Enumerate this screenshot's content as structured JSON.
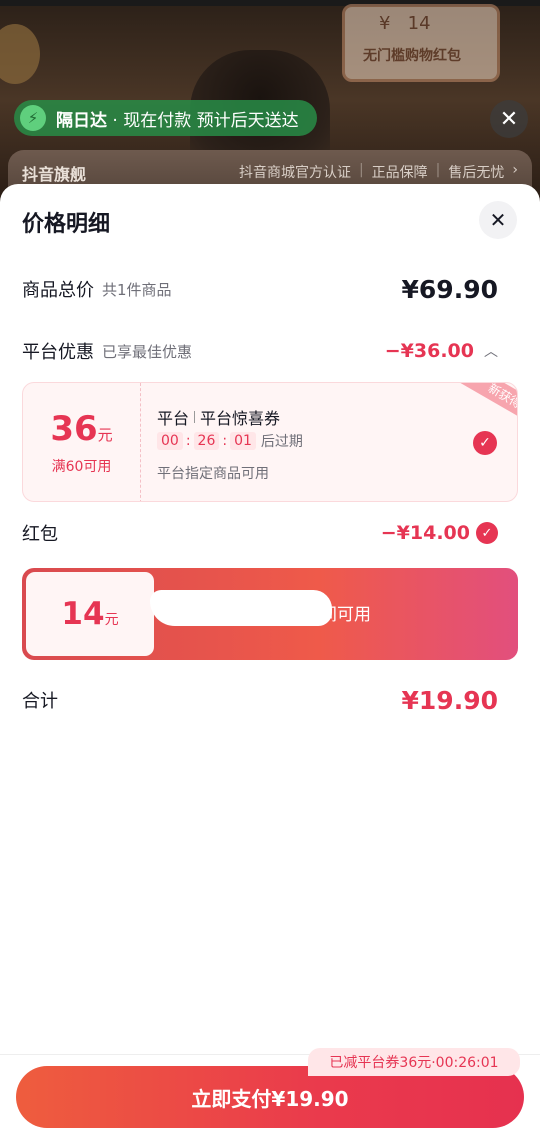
{
  "background": {
    "red_packet_card": {
      "currency": "¥",
      "amount": "14",
      "label": "无门槛购物红包"
    },
    "delivery": {
      "icon": "bolt-icon",
      "highlight": "隔日达",
      "text": " · 现在付款 预计后天送达"
    },
    "store": {
      "name": "抖音旗舰",
      "badges": [
        "抖音商城官方认证",
        "正品保障",
        "售后无忧"
      ],
      "chevron": "›"
    },
    "close_label": "✕"
  },
  "sheet": {
    "title": "价格明细",
    "close_label": "✕",
    "goods_total": {
      "label": "商品总价",
      "sub": "共1件商品",
      "value": "¥69.90"
    },
    "platform_discount": {
      "label": "平台优惠",
      "sub": "已享最佳优惠",
      "value": "−¥36.00",
      "chevron": "︿"
    },
    "coupon": {
      "amount": "36",
      "unit": "元",
      "condition": "满60可用",
      "issuer": "平台",
      "name": "平台惊喜券",
      "timer": [
        "00",
        "26",
        "01"
      ],
      "expire_text": "后过期",
      "desc": "平台指定商品可用",
      "tag": "新获得",
      "check": "✓"
    },
    "red_packet": {
      "label": "红包",
      "value": "−¥14.00",
      "check": "✓",
      "amount": "14",
      "unit": "元",
      "text": "间可用"
    },
    "sum": {
      "label": "合计",
      "value": "¥19.90"
    }
  },
  "footer": {
    "tip": "已减平台券36元·00:26:01",
    "pay_label": "立即支付¥19.90"
  },
  "colors": {
    "accent": "#e63553",
    "delivery_green": "#288c46"
  }
}
